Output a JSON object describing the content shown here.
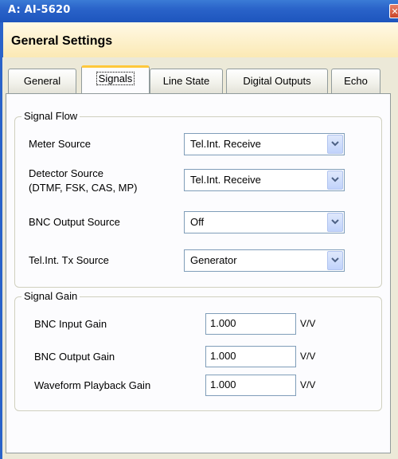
{
  "window": {
    "title": "A: AI-5620",
    "close_symbol": "✕"
  },
  "header": {
    "title": "General Settings"
  },
  "tabs": [
    {
      "label": "General",
      "active": false
    },
    {
      "label": "Signals",
      "active": true
    },
    {
      "label": "Line State",
      "active": false
    },
    {
      "label": "Digital Outputs",
      "active": false
    },
    {
      "label": "Echo",
      "active": false
    }
  ],
  "signal_flow": {
    "legend": "Signal Flow",
    "rows": [
      {
        "label": "Meter Source",
        "value": "Tel.Int. Receive"
      },
      {
        "label_line1": "Detector Source",
        "label_line2": "(DTMF, FSK, CAS, MP)",
        "value": "Tel.Int. Receive"
      },
      {
        "label": "BNC Output Source",
        "value": "Off"
      },
      {
        "label": "Tel.Int. Tx Source",
        "value": "Generator"
      }
    ]
  },
  "signal_gain": {
    "legend": "Signal Gain",
    "rows": [
      {
        "label": "BNC Input Gain",
        "value": "1.000",
        "unit": "V/V"
      },
      {
        "label": "BNC Output Gain",
        "value": "1.000",
        "unit": "V/V"
      },
      {
        "label": "Waveform Playback Gain",
        "value": "1.000",
        "unit": "V/V"
      }
    ]
  },
  "colors": {
    "titlebar": "#2a63c9",
    "header_band": "#fbe9b4",
    "active_tab_accent": "#ffc83c",
    "input_border": "#7f9db9"
  }
}
